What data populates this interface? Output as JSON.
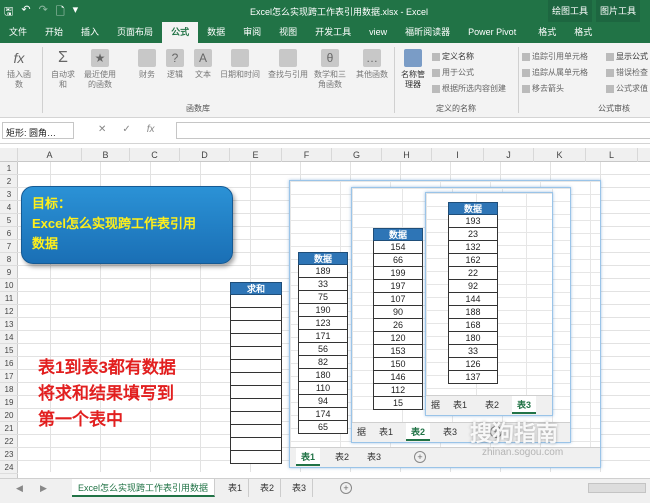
{
  "titlebar": {
    "title": "Excel怎么实现跨工作表引用数据.xlsx - Excel",
    "ctx_draw": "绘图工具",
    "ctx_pic": "图片工具"
  },
  "tabs": [
    "文件",
    "开始",
    "插入",
    "页面布局",
    "公式",
    "数据",
    "审阅",
    "视图",
    "开发工具",
    "view",
    "福昕阅读器",
    "Power Pivot",
    "格式",
    "格式"
  ],
  "ribbon": {
    "insert_fn": "插入函数",
    "autosum": "自动求和",
    "recent": "最近使用的函数",
    "finance": "财务",
    "logic": "逻辑",
    "text": "文本",
    "datetime": "日期和时间",
    "lookup": "查找与引用",
    "math": "数学和三角函数",
    "other": "其他函数",
    "name_mgr": "名称管理器",
    "define_name": "定义名称",
    "use_formula": "用于公式",
    "create_sel": "根据所选内容创建",
    "trace_prec": "追踪引用单元格",
    "trace_dep": "追踪从属单元格",
    "remove_arrows": "移去箭头",
    "show_formula": "显示公式",
    "error_check": "错误检查",
    "eval_formula": "公式求值",
    "group_lib": "函数库",
    "group_names": "定义的名称",
    "group_audit": "公式审核"
  },
  "formula_bar": {
    "namebox": "矩形: 圆角…",
    "cancel": "✕",
    "enter": "✓",
    "fx": "fx"
  },
  "columns": [
    "A",
    "B",
    "C",
    "D",
    "E",
    "F",
    "G",
    "H",
    "I",
    "J",
    "K",
    "L"
  ],
  "rows": [
    "1",
    "2",
    "3",
    "4",
    "5",
    "6",
    "7",
    "8",
    "9",
    "10",
    "11",
    "12",
    "13",
    "14",
    "15",
    "16",
    "17",
    "18",
    "19",
    "20",
    "21",
    "22",
    "23",
    "24"
  ],
  "callout": {
    "line1": "目标：",
    "line2": "Excel怎么实现跨工作表引用",
    "line3": "数据"
  },
  "red_note": [
    "表1到表3都有数据",
    "将求和结果填写到",
    "第一个表中"
  ],
  "sum_table": {
    "header": "求和"
  },
  "sheet1_data": {
    "header": "数据",
    "values": [
      "189",
      "33",
      "75",
      "190",
      "123",
      "171",
      "56",
      "82",
      "180",
      "110",
      "94",
      "174",
      "65"
    ]
  },
  "sheet2_data": {
    "header": "数据",
    "values": [
      "154",
      "66",
      "199",
      "197",
      "107",
      "90",
      "26",
      "120",
      "153",
      "150",
      "146",
      "112",
      "15"
    ]
  },
  "sheet3_data": {
    "header": "数据",
    "values": [
      "193",
      "23",
      "132",
      "162",
      "22",
      "92",
      "144",
      "188",
      "168",
      "180",
      "33",
      "126",
      "137"
    ]
  },
  "sheet_tabs": {
    "t1": "表1",
    "t2": "表2",
    "t3": "表3",
    "cut": "据",
    "plus": "+"
  },
  "bottom_tabs": {
    "main": "Excel怎么实现跨工作表引用数据",
    "t1": "表1",
    "t2": "表2",
    "t3": "表3",
    "plus": "+"
  },
  "watermark": {
    "line1": "搜狗指南",
    "line2": "zhinan.sogou.com"
  }
}
